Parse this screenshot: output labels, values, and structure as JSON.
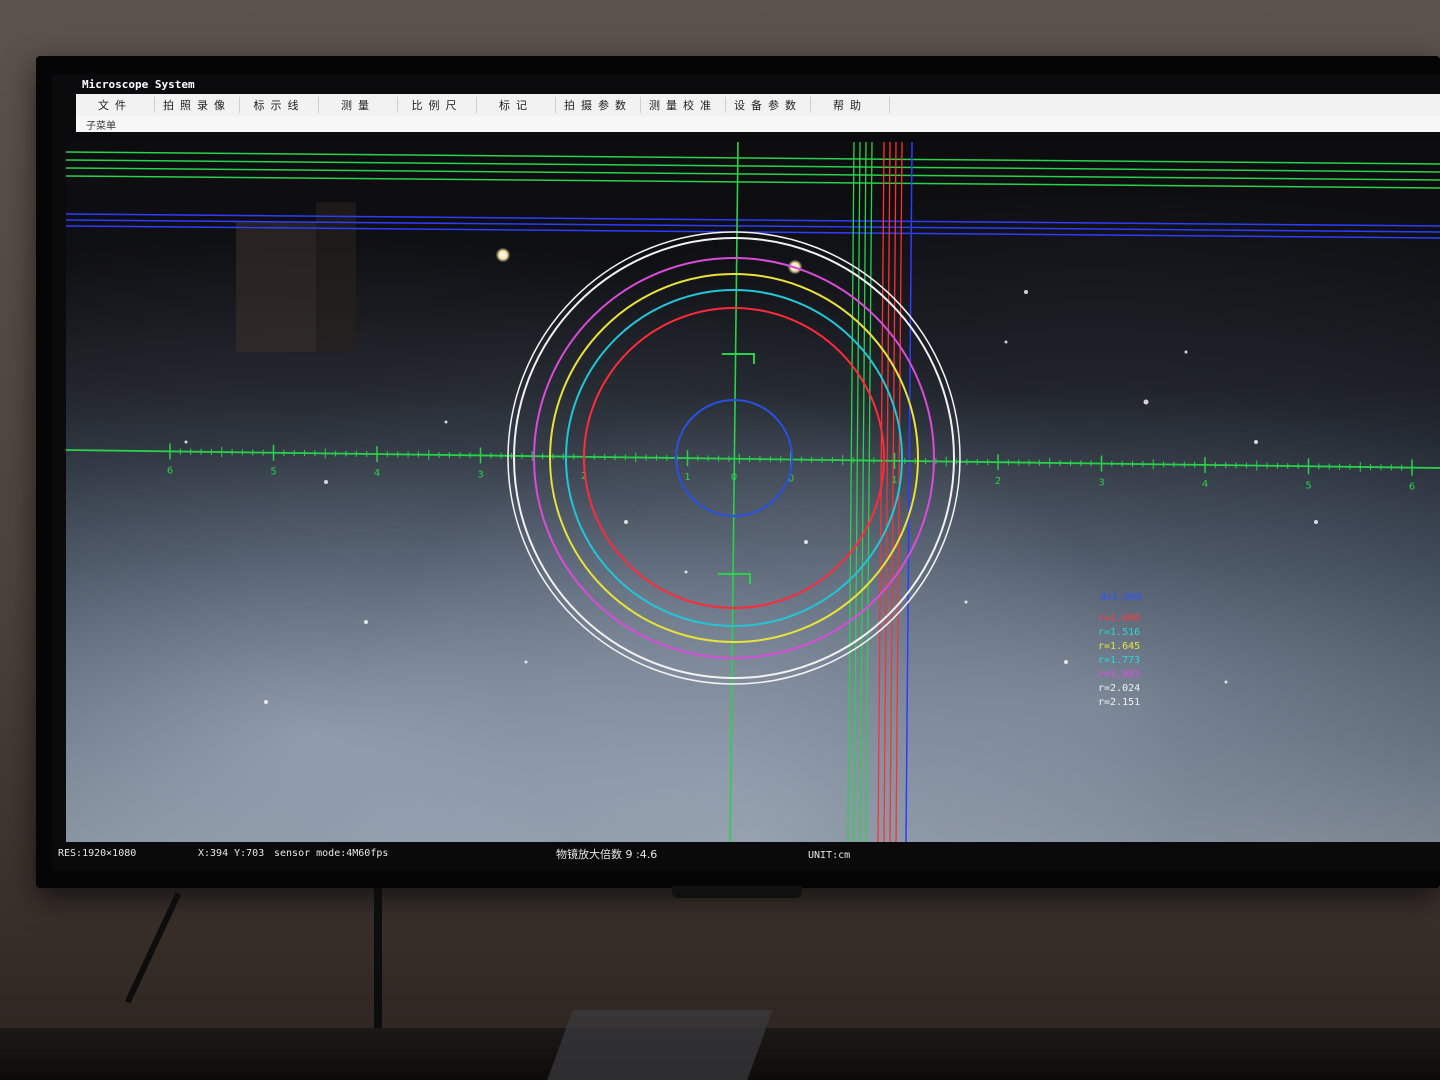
{
  "window": {
    "title": "Microscope System"
  },
  "menu": {
    "items": [
      {
        "label": "文件"
      },
      {
        "label": "拍照录像"
      },
      {
        "label": "标示线"
      },
      {
        "label": "测量"
      },
      {
        "label": "比例尺"
      },
      {
        "label": "标记"
      },
      {
        "label": "拍摄参数"
      },
      {
        "label": "测量校准"
      },
      {
        "label": "设备参数"
      },
      {
        "label": "帮助"
      }
    ],
    "submenu_label": "子菜单"
  },
  "overlay": {
    "axis_ticks": [
      "6",
      "5",
      "4",
      "3",
      "2",
      "1",
      "0",
      "1",
      "2",
      "3",
      "4",
      "5",
      "6"
    ],
    "center_label": "0",
    "circles": [
      {
        "name": "blue",
        "color": "#2a50e0"
      },
      {
        "name": "red",
        "color": "#ff2a3a"
      },
      {
        "name": "cyan",
        "color": "#22c6d6"
      },
      {
        "name": "yellow",
        "color": "#e8e23a"
      },
      {
        "name": "magenta",
        "color": "#d84cd8"
      },
      {
        "name": "white",
        "color": "#f2f2f2"
      }
    ],
    "line_colors": {
      "green": "#28d24a",
      "blue": "#2d3cff",
      "red": "#ff3030"
    }
  },
  "legend": {
    "blue_label": "d=1.000",
    "entries": [
      {
        "label": "r=1.000",
        "color": "#ff3b3b"
      },
      {
        "label": "r=1.516",
        "color": "#2ad6d6"
      },
      {
        "label": "r=1.645",
        "color": "#e6e23a"
      },
      {
        "label": "r=1.773",
        "color": "#2ad6d6"
      },
      {
        "label": "r=1.893",
        "color": "#e04ce0"
      },
      {
        "label": "r=2.024",
        "color": "#f0f0f0"
      },
      {
        "label": "r=2.151",
        "color": "#f0f0f0"
      }
    ]
  },
  "status": {
    "resolution": "RES:1920×1080",
    "cursor": "X:394 Y:703",
    "sensor_mode": "sensor mode:4M60fps",
    "magnification": "物镜放大倍数 9 :4.6",
    "unit": "UNIT:cm"
  }
}
